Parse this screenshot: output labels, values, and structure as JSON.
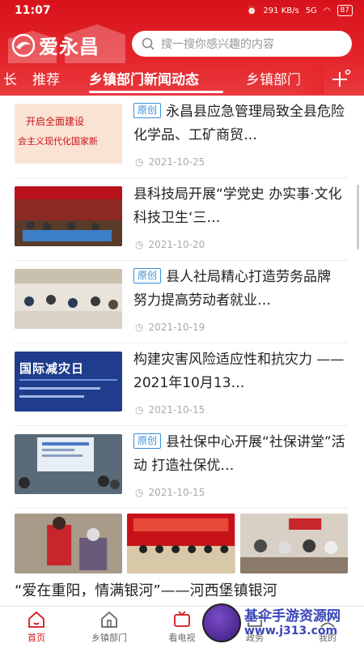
{
  "status_bar": {
    "time": "11:07",
    "network": "291 KB/s",
    "signal": "5G",
    "battery": "87"
  },
  "app": {
    "name": "爱永昌"
  },
  "search": {
    "placeholder": "搜一搜你感兴趣的内容"
  },
  "tabs": [
    {
      "label": "长"
    },
    {
      "label": "推荐"
    },
    {
      "label": "乡镇部门新闻动态",
      "active": true
    },
    {
      "label": "乡镇部门"
    }
  ],
  "articles": [
    {
      "badge": "原创",
      "title": "永昌县应急管理局致全县危险化学品、工矿商贸…",
      "date": "2021-10-25",
      "thumb_text": "开启全面建设 社会主义现代化国家新"
    },
    {
      "badge": "",
      "title": "县科技局开展“学党史 办实事·文化科技卫生‘三…",
      "date": "2021-10-20",
      "thumb_text": ""
    },
    {
      "badge": "原创",
      "title": "县人社局精心打造劳务品牌 努力提高劳动者就业…",
      "date": "2021-10-19",
      "thumb_text": ""
    },
    {
      "badge": "",
      "title": "构建灾害风险适应性和抗灾力 —— 2021年10月13…",
      "date": "2021-10-15",
      "thumb_text": "国际减灾日"
    },
    {
      "badge": "原创",
      "title": "县社保中心开展“社保讲堂”活动 打造社保优…",
      "date": "2021-10-15",
      "thumb_text": ""
    }
  ],
  "featured": {
    "title": "“爱在重阳，情满银河”——河西堡镇银河"
  },
  "bottom_nav": [
    {
      "label": "首页",
      "active": true
    },
    {
      "label": "乡镇部门"
    },
    {
      "label": "看电视"
    },
    {
      "label": "政务"
    },
    {
      "label": "我的"
    }
  ],
  "watermark": {
    "text": "基伞手游资源网",
    "url": "www.j313.com"
  },
  "colors": {
    "brand_red": "#d8121a",
    "badge_blue": "#3a8fd8"
  }
}
